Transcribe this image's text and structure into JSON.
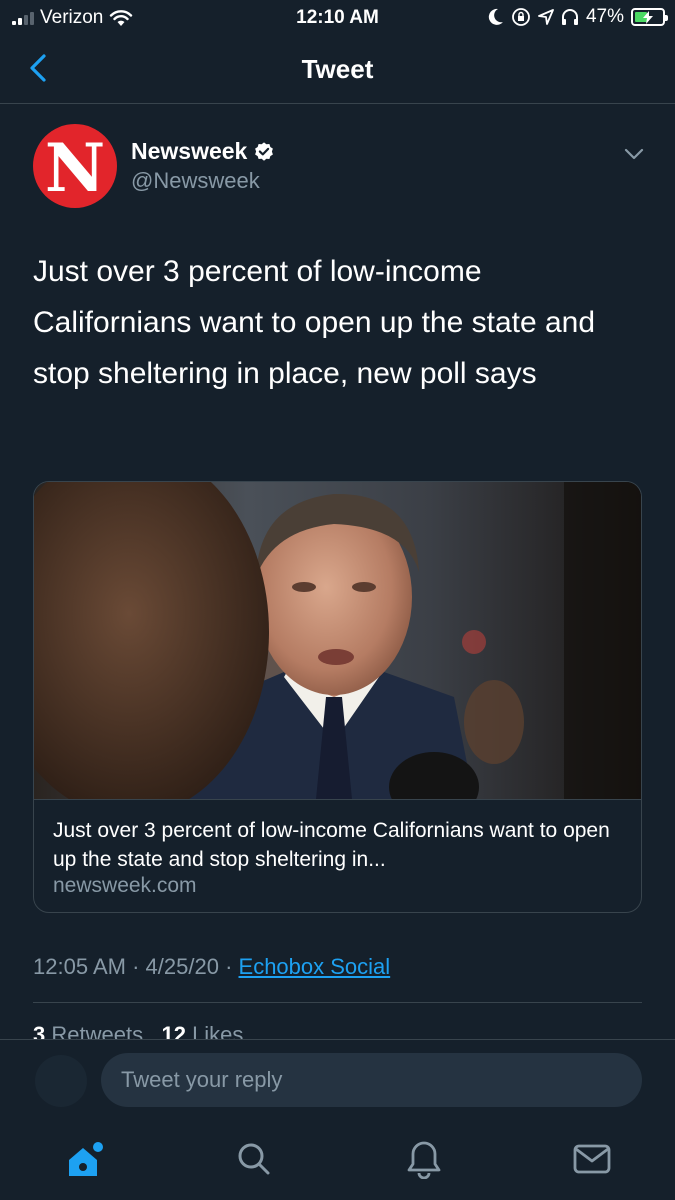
{
  "status_bar": {
    "carrier": "Verizon",
    "time": "12:10 AM",
    "battery_percent": "47%",
    "battery_level": 0.47,
    "battery_color": "#4cd964",
    "icons": [
      "signal-icon",
      "wifi-icon",
      "moon-icon",
      "orientation-lock-icon",
      "location-icon",
      "headphones-icon",
      "battery-icon"
    ]
  },
  "nav": {
    "title": "Tweet",
    "back_icon": "chevron-left-icon"
  },
  "tweet": {
    "author": {
      "avatar_letter": "N",
      "avatar_color": "#e2252b",
      "name": "Newsweek",
      "handle": "@Newsweek",
      "verified": true
    },
    "text": "Just over 3 percent of low-income Californians want to open up the state and stop sheltering in place, new poll says",
    "card": {
      "title": "Just over 3 percent of low-income Californians want to open up the state and stop sheltering in...",
      "domain": "newsweek.com"
    },
    "meta": {
      "time": "12:05 AM",
      "separator": "·",
      "date": "4/25/20",
      "source": "Echobox Social"
    },
    "stats": {
      "retweets_count": "3",
      "retweets_label": "Retweets",
      "likes_count": "12",
      "likes_label": "Likes"
    }
  },
  "reply": {
    "placeholder": "Tweet your reply"
  },
  "tab_bar": {
    "tabs": [
      "home-icon",
      "search-icon",
      "notifications-icon",
      "messages-icon"
    ]
  },
  "colors": {
    "background": "#15202b",
    "accent": "#1da1f2",
    "secondary_text": "#8899a6",
    "border": "#38444d"
  }
}
